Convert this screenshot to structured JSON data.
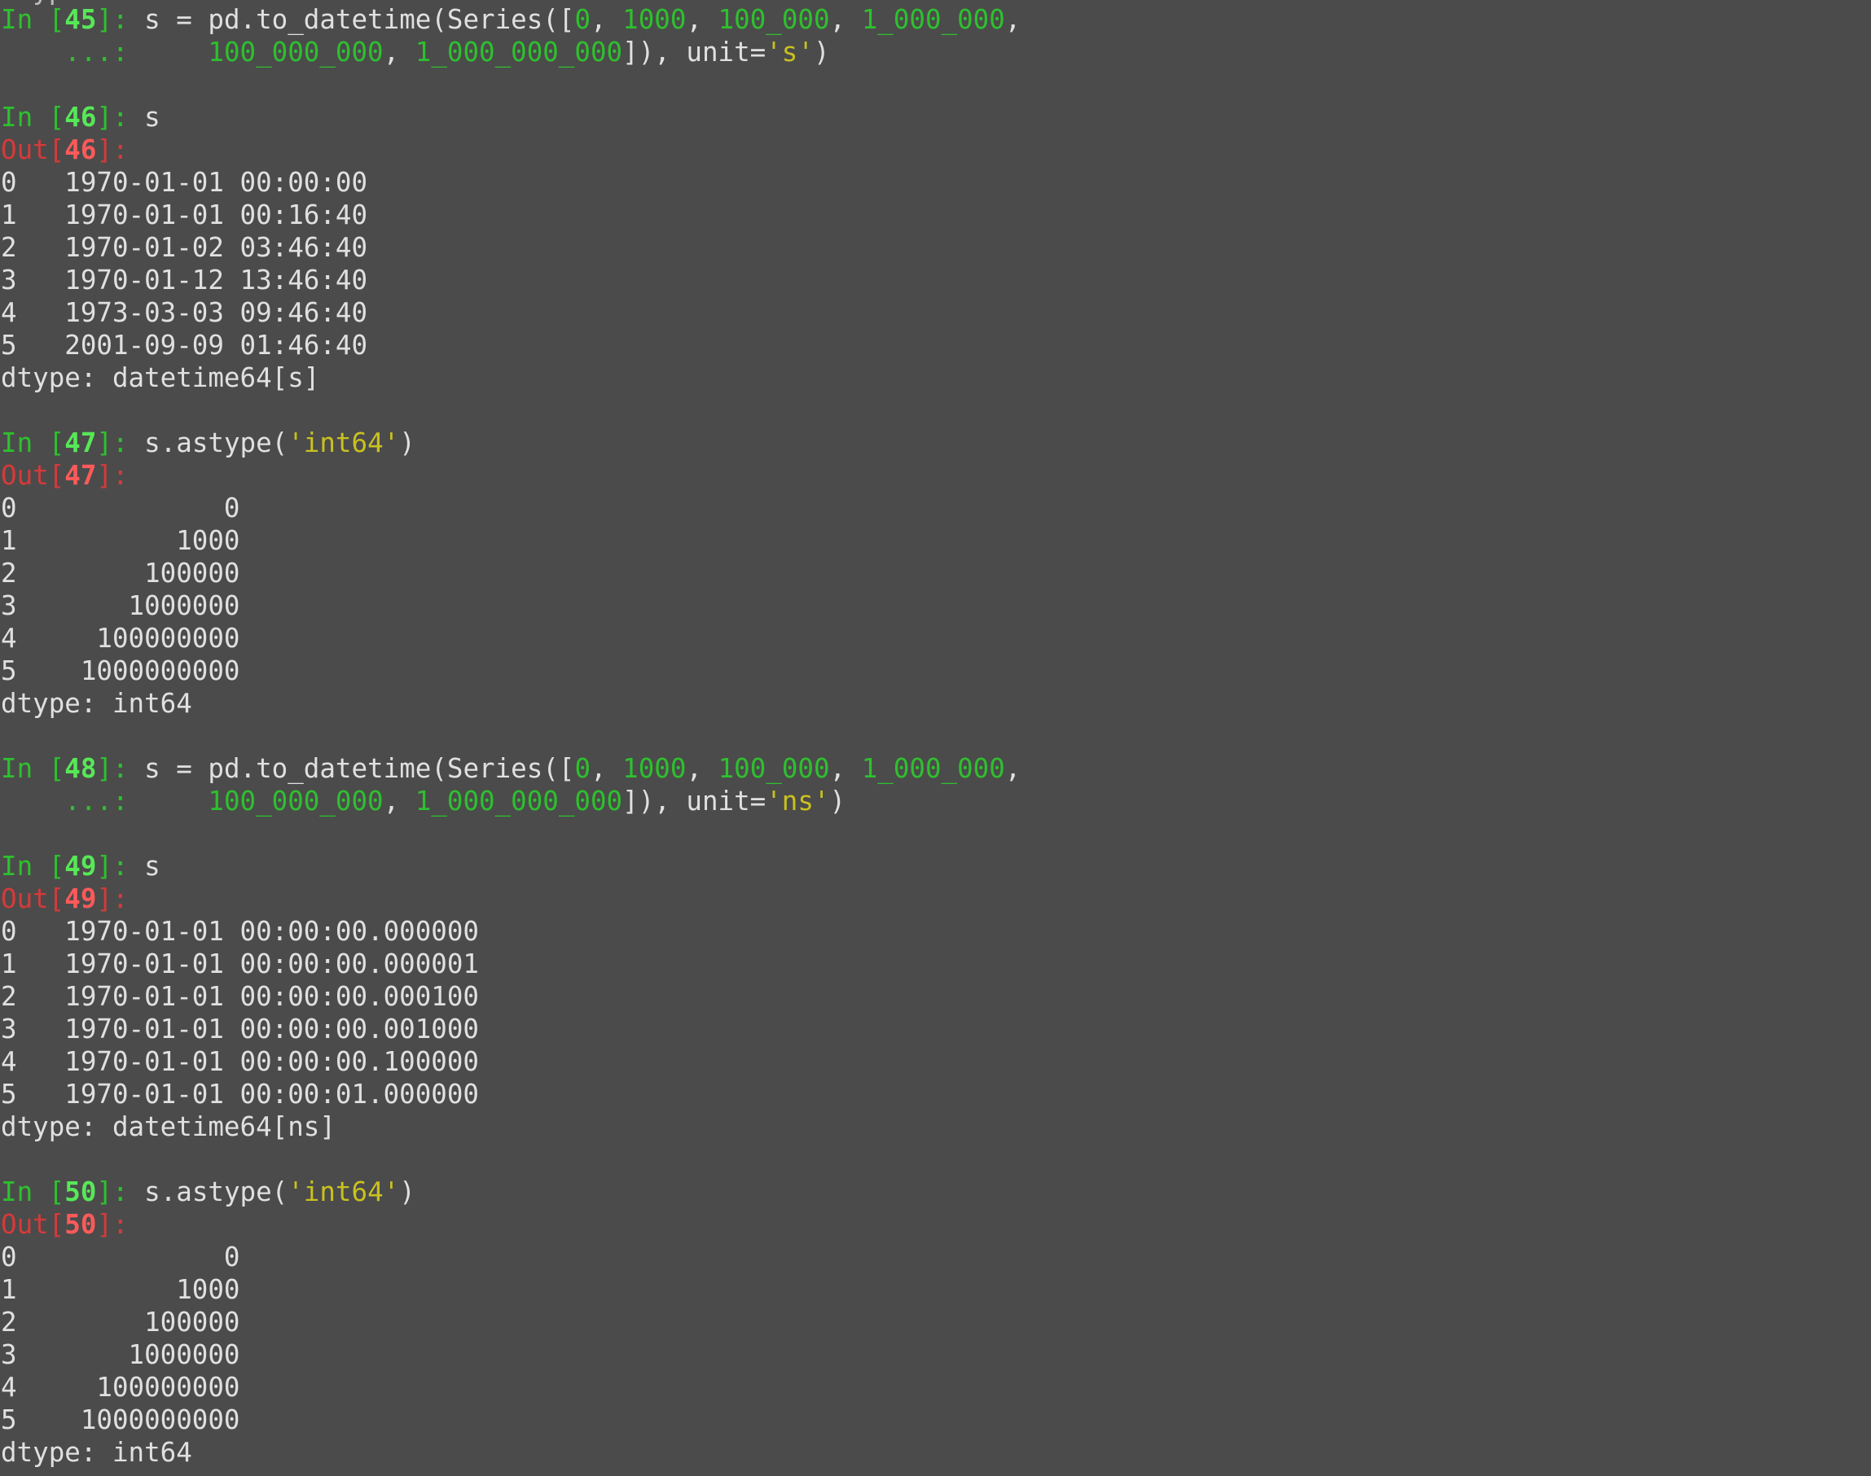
{
  "terminal": {
    "colors": {
      "background": "#4b4b4b",
      "text": "#e0e0e0",
      "prompt_green": "#2ec02e",
      "prompt_number_green": "#57e857",
      "out_red": "#d63a3a",
      "out_number_red": "#ff5a5a",
      "string_yellow": "#c9c11e"
    },
    "top_clipped_text": "dtype",
    "lines": [
      [
        {
          "t": "In [",
          "c": "g"
        },
        {
          "t": "45",
          "c": "gb"
        },
        {
          "t": "]: ",
          "c": "g"
        },
        {
          "t": "s = pd.to_datetime(Series([",
          "c": "t"
        },
        {
          "t": "0",
          "c": "g"
        },
        {
          "t": ", ",
          "c": "t"
        },
        {
          "t": "1000",
          "c": "g"
        },
        {
          "t": ", ",
          "c": "t"
        },
        {
          "t": "100_000",
          "c": "g"
        },
        {
          "t": ", ",
          "c": "t"
        },
        {
          "t": "1_000_000",
          "c": "g"
        },
        {
          "t": ",",
          "c": "t"
        }
      ],
      [
        {
          "t": "    ...:     ",
          "c": "g"
        },
        {
          "t": "100_000_000",
          "c": "g"
        },
        {
          "t": ", ",
          "c": "t"
        },
        {
          "t": "1_000_000_000",
          "c": "g"
        },
        {
          "t": "]), unit=",
          "c": "t"
        },
        {
          "t": "'s'",
          "c": "y"
        },
        {
          "t": ")",
          "c": "t"
        }
      ],
      [],
      [
        {
          "t": "In [",
          "c": "g"
        },
        {
          "t": "46",
          "c": "gb"
        },
        {
          "t": "]: ",
          "c": "g"
        },
        {
          "t": "s",
          "c": "t"
        }
      ],
      [
        {
          "t": "Out[",
          "c": "r"
        },
        {
          "t": "46",
          "c": "rb"
        },
        {
          "t": "]:",
          "c": "r"
        }
      ],
      [
        {
          "t": "0   1970-01-01 00:00:00",
          "c": "t"
        }
      ],
      [
        {
          "t": "1   1970-01-01 00:16:40",
          "c": "t"
        }
      ],
      [
        {
          "t": "2   1970-01-02 03:46:40",
          "c": "t"
        }
      ],
      [
        {
          "t": "3   1970-01-12 13:46:40",
          "c": "t"
        }
      ],
      [
        {
          "t": "4   1973-03-03 09:46:40",
          "c": "t"
        }
      ],
      [
        {
          "t": "5   2001-09-09 01:46:40",
          "c": "t"
        }
      ],
      [
        {
          "t": "dtype: datetime64[s]",
          "c": "t"
        }
      ],
      [],
      [
        {
          "t": "In [",
          "c": "g"
        },
        {
          "t": "47",
          "c": "gb"
        },
        {
          "t": "]: ",
          "c": "g"
        },
        {
          "t": "s.astype(",
          "c": "t"
        },
        {
          "t": "'int64'",
          "c": "y"
        },
        {
          "t": ")",
          "c": "t"
        }
      ],
      [
        {
          "t": "Out[",
          "c": "r"
        },
        {
          "t": "47",
          "c": "rb"
        },
        {
          "t": "]:",
          "c": "r"
        }
      ],
      [
        {
          "t": "0             0",
          "c": "t"
        }
      ],
      [
        {
          "t": "1          1000",
          "c": "t"
        }
      ],
      [
        {
          "t": "2        100000",
          "c": "t"
        }
      ],
      [
        {
          "t": "3       1000000",
          "c": "t"
        }
      ],
      [
        {
          "t": "4     100000000",
          "c": "t"
        }
      ],
      [
        {
          "t": "5    1000000000",
          "c": "t"
        }
      ],
      [
        {
          "t": "dtype: int64",
          "c": "t"
        }
      ],
      [],
      [
        {
          "t": "In [",
          "c": "g"
        },
        {
          "t": "48",
          "c": "gb"
        },
        {
          "t": "]: ",
          "c": "g"
        },
        {
          "t": "s = pd.to_datetime(Series([",
          "c": "t"
        },
        {
          "t": "0",
          "c": "g"
        },
        {
          "t": ", ",
          "c": "t"
        },
        {
          "t": "1000",
          "c": "g"
        },
        {
          "t": ", ",
          "c": "t"
        },
        {
          "t": "100_000",
          "c": "g"
        },
        {
          "t": ", ",
          "c": "t"
        },
        {
          "t": "1_000_000",
          "c": "g"
        },
        {
          "t": ",",
          "c": "t"
        }
      ],
      [
        {
          "t": "    ...:     ",
          "c": "g"
        },
        {
          "t": "100_000_000",
          "c": "g"
        },
        {
          "t": ", ",
          "c": "t"
        },
        {
          "t": "1_000_000_000",
          "c": "g"
        },
        {
          "t": "]), unit=",
          "c": "t"
        },
        {
          "t": "'ns'",
          "c": "y"
        },
        {
          "t": ")",
          "c": "t"
        }
      ],
      [],
      [
        {
          "t": "In [",
          "c": "g"
        },
        {
          "t": "49",
          "c": "gb"
        },
        {
          "t": "]: ",
          "c": "g"
        },
        {
          "t": "s",
          "c": "t"
        }
      ],
      [
        {
          "t": "Out[",
          "c": "r"
        },
        {
          "t": "49",
          "c": "rb"
        },
        {
          "t": "]:",
          "c": "r"
        }
      ],
      [
        {
          "t": "0   1970-01-01 00:00:00.000000",
          "c": "t"
        }
      ],
      [
        {
          "t": "1   1970-01-01 00:00:00.000001",
          "c": "t"
        }
      ],
      [
        {
          "t": "2   1970-01-01 00:00:00.000100",
          "c": "t"
        }
      ],
      [
        {
          "t": "3   1970-01-01 00:00:00.001000",
          "c": "t"
        }
      ],
      [
        {
          "t": "4   1970-01-01 00:00:00.100000",
          "c": "t"
        }
      ],
      [
        {
          "t": "5   1970-01-01 00:00:01.000000",
          "c": "t"
        }
      ],
      [
        {
          "t": "dtype: datetime64[ns]",
          "c": "t"
        }
      ],
      [],
      [
        {
          "t": "In [",
          "c": "g"
        },
        {
          "t": "50",
          "c": "gb"
        },
        {
          "t": "]: ",
          "c": "g"
        },
        {
          "t": "s.astype(",
          "c": "t"
        },
        {
          "t": "'int64'",
          "c": "y"
        },
        {
          "t": ")",
          "c": "t"
        }
      ],
      [
        {
          "t": "Out[",
          "c": "r"
        },
        {
          "t": "50",
          "c": "rb"
        },
        {
          "t": "]:",
          "c": "r"
        }
      ],
      [
        {
          "t": "0             0",
          "c": "t"
        }
      ],
      [
        {
          "t": "1          1000",
          "c": "t"
        }
      ],
      [
        {
          "t": "2        100000",
          "c": "t"
        }
      ],
      [
        {
          "t": "3       1000000",
          "c": "t"
        }
      ],
      [
        {
          "t": "4     100000000",
          "c": "t"
        }
      ],
      [
        {
          "t": "5    1000000000",
          "c": "t"
        }
      ],
      [
        {
          "t": "dtype: int64",
          "c": "t"
        }
      ]
    ]
  }
}
